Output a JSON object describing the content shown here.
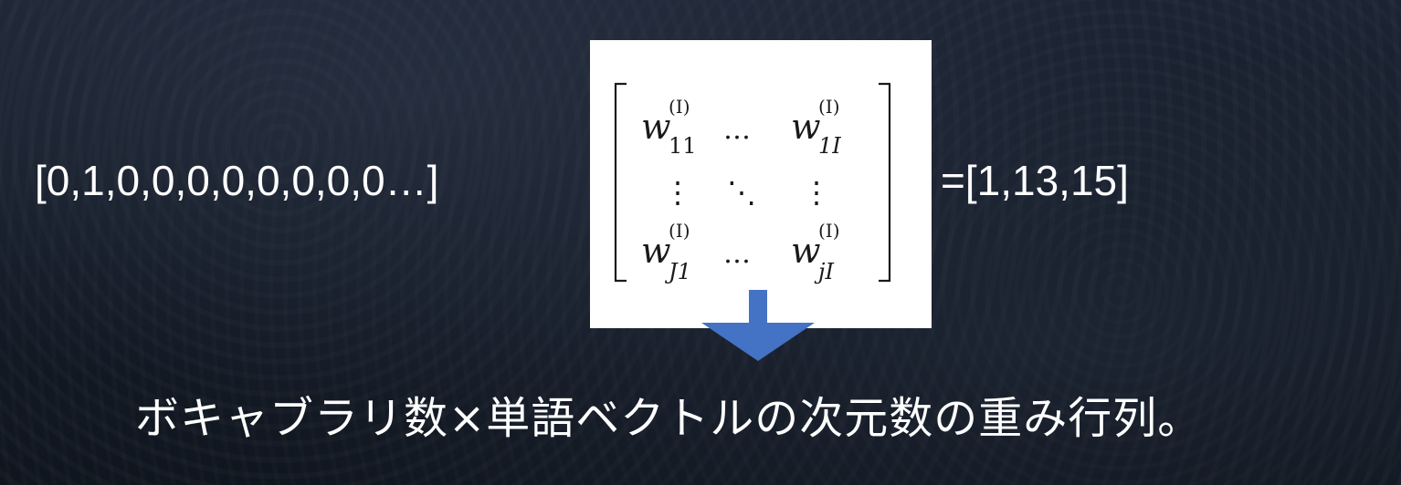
{
  "input_vector": "[0,1,0,0,0,0,0,0,0,0…]",
  "matrix": {
    "top_left": "w",
    "top_left_super": "(I)",
    "top_left_sub": "11",
    "top_right": "w",
    "top_right_super": "(I)",
    "top_right_sub": "1I",
    "bottom_left": "w",
    "bottom_left_super": "(I)",
    "bottom_left_sub": "J1",
    "bottom_right": "w",
    "bottom_right_super": "(I)",
    "bottom_right_sub": "jI",
    "hdots": "…",
    "vdots": "⋮",
    "ddots": "⋱"
  },
  "result_vector": "=[1,13,15]",
  "caption": "ボキャブラリ数×単語ベクトルの次元数の重み行列。",
  "colors": {
    "arrow": "#4472c4",
    "text": "#ffffff",
    "card": "#ffffff"
  }
}
